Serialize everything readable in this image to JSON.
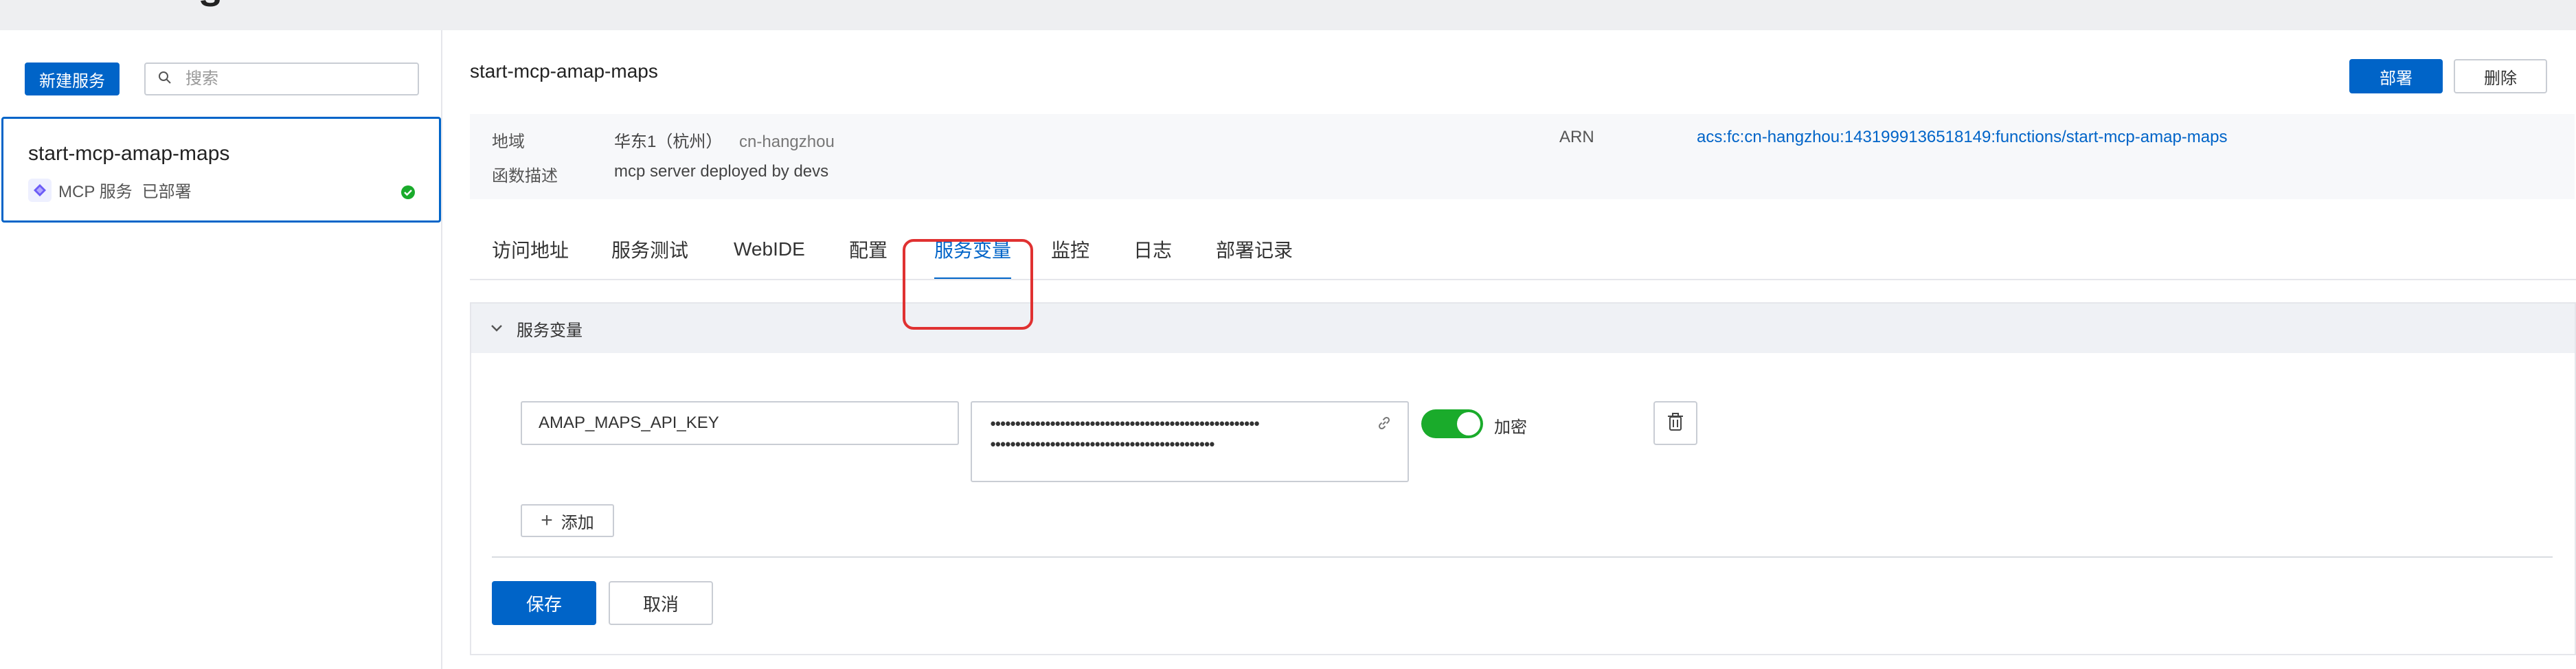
{
  "top_cut_text": "s",
  "sidebar": {
    "new_service_label": "新建服务",
    "search_placeholder": "搜索",
    "service": {
      "name": "start-mcp-amap-maps",
      "type": "MCP 服务",
      "status": "已部署"
    }
  },
  "header": {
    "title": "start-mcp-amap-maps",
    "deploy_label": "部署",
    "delete_label": "删除"
  },
  "info": {
    "region_key": "地域",
    "region_value": "华东1（杭州）",
    "region_code": "cn-hangzhou",
    "desc_key": "函数描述",
    "desc_value": "mcp server deployed by devs",
    "arn_key": "ARN",
    "arn_value": "acs:fc:cn-hangzhou:1431999136518149:functions/start-mcp-amap-maps"
  },
  "tabs": [
    {
      "label": "访问地址"
    },
    {
      "label": "服务测试"
    },
    {
      "label": "WebIDE"
    },
    {
      "label": "配置"
    },
    {
      "label": "服务变量"
    },
    {
      "label": "监控"
    },
    {
      "label": "日志"
    },
    {
      "label": "部署记录"
    }
  ],
  "active_tab": "服务变量",
  "variables_section": {
    "title": "服务变量",
    "rows": [
      {
        "key": "AMAP_MAPS_API_KEY",
        "masked_value_line1": "••••••••••••••••••••••••••••••••••••••••••••••••••••••",
        "masked_value_line2": "•••••••••••••••••••••••••••••••••••••••••••••",
        "encrypt_label": "加密",
        "encrypt_enabled": true
      }
    ],
    "add_label": "添加"
  },
  "actions": {
    "save_label": "保存",
    "cancel_label": "取消"
  },
  "colors": {
    "primary": "#0064c8",
    "toggle_on": "#1aab2b",
    "highlight": "#e03131",
    "success": "#1aab2b"
  }
}
